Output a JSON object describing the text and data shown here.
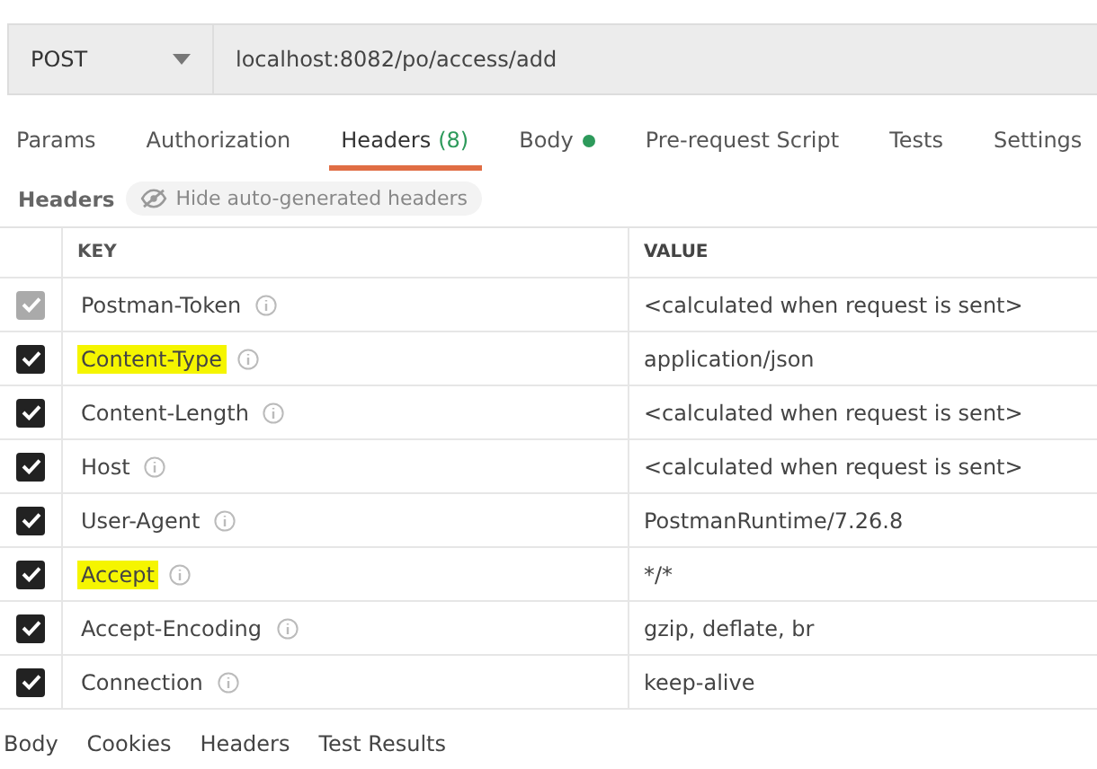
{
  "request": {
    "method": "POST",
    "url": "localhost:8082/po/access/add"
  },
  "tabs": [
    {
      "label": "Params",
      "selected": false
    },
    {
      "label": "Authorization",
      "selected": false
    },
    {
      "label": "Headers",
      "count": "(8)",
      "selected": true
    },
    {
      "label": "Body",
      "dot": true,
      "selected": false
    },
    {
      "label": "Pre-request Script",
      "selected": false
    },
    {
      "label": "Tests",
      "selected": false
    },
    {
      "label": "Settings",
      "selected": false
    }
  ],
  "headers_bar": {
    "title": "Headers",
    "toggle": "Hide auto-generated headers"
  },
  "table": {
    "columns": [
      "KEY",
      "VALUE"
    ],
    "rows": [
      {
        "key": "Postman-Token",
        "value": "<calculated when request is sent>",
        "checked": true,
        "disabled": true,
        "highlighted": false
      },
      {
        "key": "Content-Type",
        "value": "application/json",
        "checked": true,
        "disabled": false,
        "highlighted": true
      },
      {
        "key": "Content-Length",
        "value": "<calculated when request is sent>",
        "checked": true,
        "disabled": false,
        "highlighted": false
      },
      {
        "key": "Host",
        "value": "<calculated when request is sent>",
        "checked": true,
        "disabled": false,
        "highlighted": false
      },
      {
        "key": "User-Agent",
        "value": "PostmanRuntime/7.26.8",
        "checked": true,
        "disabled": false,
        "highlighted": false
      },
      {
        "key": "Accept",
        "value": "*/*",
        "checked": true,
        "disabled": false,
        "highlighted": true
      },
      {
        "key": "Accept-Encoding",
        "value": "gzip, deflate, br",
        "checked": true,
        "disabled": false,
        "highlighted": false
      },
      {
        "key": "Connection",
        "value": "keep-alive",
        "checked": true,
        "disabled": false,
        "highlighted": false
      }
    ]
  },
  "response_tabs": [
    {
      "label": "Body",
      "selected": false
    },
    {
      "label": "Cookies",
      "selected": false
    },
    {
      "label": "Headers",
      "selected": false
    },
    {
      "label": "Test Results",
      "selected": false
    }
  ]
}
